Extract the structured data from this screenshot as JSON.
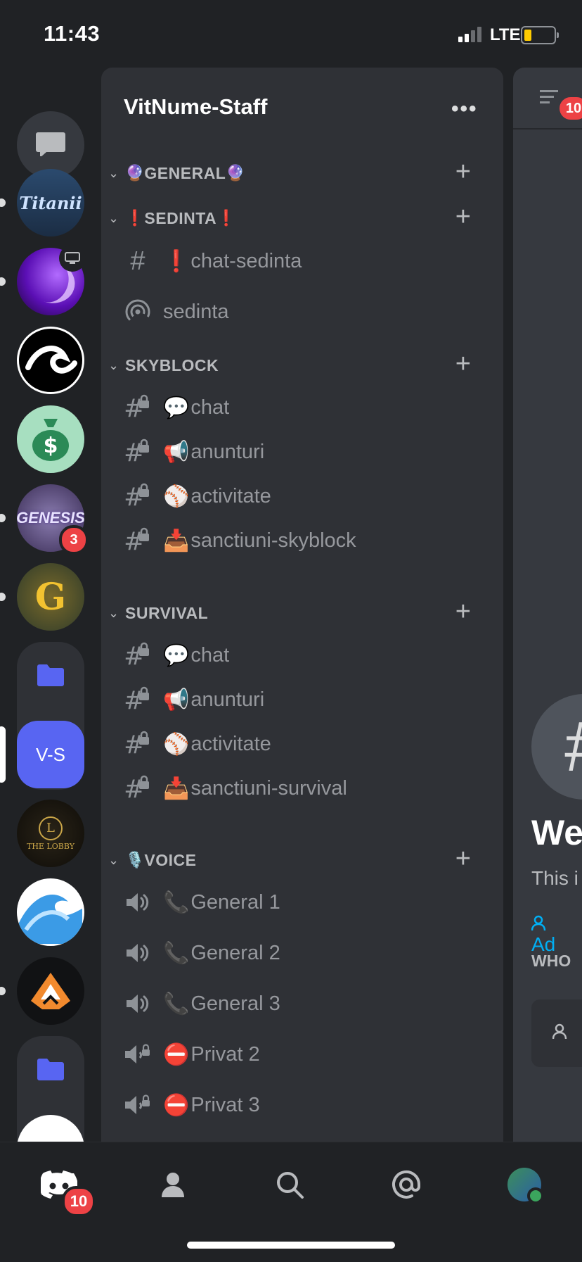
{
  "status_bar": {
    "time": "11:43",
    "network": "LTE"
  },
  "rail": {
    "badges": {
      "genesis": "3"
    },
    "vs_label": "V-S",
    "titanii_label": "Titanii",
    "genesis_label": "GENESIS",
    "lobby_label": "THE LOBBY"
  },
  "guild": {
    "name": "VitNume-Staff",
    "categories": [
      {
        "label": "GENERAL",
        "emoji_left": "🔮",
        "emoji_right": "🔮"
      },
      {
        "label": "SEDINTA",
        "emoji_left": "❗",
        "emoji_right": "❗"
      },
      {
        "label": "SKYBLOCK"
      },
      {
        "label": "SURVIVAL"
      },
      {
        "label": "VOICE",
        "emoji_left": "🎙️"
      }
    ],
    "channels": {
      "sedinta_chat": {
        "emoji": "❗",
        "name": "chat-sedinta"
      },
      "sedinta_stage": {
        "name": "sedinta"
      },
      "skyblock": [
        {
          "emoji": "💬",
          "name": "chat"
        },
        {
          "emoji": "📢",
          "name": "anunturi"
        },
        {
          "emoji": "⚾",
          "name": "activitate"
        },
        {
          "emoji": "📥",
          "name": "sanctiuni-skyblock"
        }
      ],
      "survival": [
        {
          "emoji": "💬",
          "name": "chat"
        },
        {
          "emoji": "📢",
          "name": "anunturi"
        },
        {
          "emoji": "⚾",
          "name": "activitate"
        },
        {
          "emoji": "📥",
          "name": "sanctiuni-survival"
        }
      ],
      "voice": [
        {
          "emoji": "📞",
          "name": "General 1"
        },
        {
          "emoji": "📞",
          "name": "General 2"
        },
        {
          "emoji": "📞",
          "name": "General 3"
        },
        {
          "emoji": "⛔",
          "name": "Privat 2"
        },
        {
          "emoji": "⛔",
          "name": "Privat 3"
        }
      ]
    }
  },
  "peek": {
    "header_badge": "10",
    "welcome_partial": "We",
    "desc_partial": "This i",
    "add_partial": "Ad",
    "who_partial": "WHO",
    "channel_glyph": "#"
  },
  "nav": {
    "home_badge": "10"
  },
  "colors": {
    "blurple": "#5865f2",
    "danger": "#ed4245",
    "online": "#3ba55d",
    "link": "#00aff4"
  }
}
